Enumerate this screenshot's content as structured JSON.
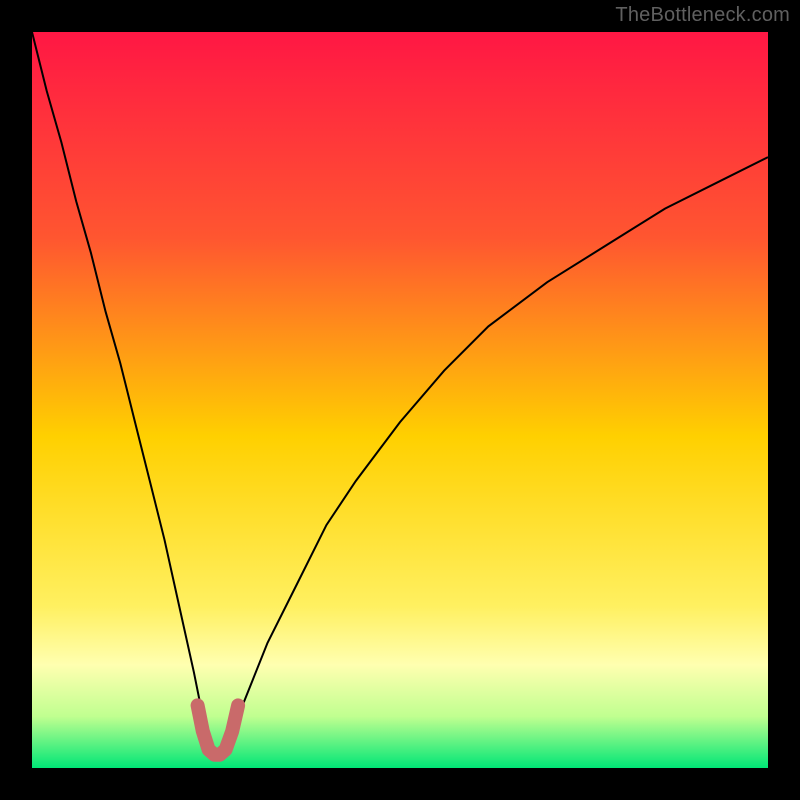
{
  "watermark": {
    "text": "TheBottleneck.com"
  },
  "chart_data": {
    "type": "line",
    "title": "",
    "xlabel": "",
    "ylabel": "",
    "xlim": [
      0,
      100
    ],
    "ylim": [
      0,
      100
    ],
    "gradient_stops": [
      {
        "offset": 0,
        "color": "#ff1744"
      },
      {
        "offset": 28,
        "color": "#ff5630"
      },
      {
        "offset": 55,
        "color": "#ffd000"
      },
      {
        "offset": 78,
        "color": "#fff060"
      },
      {
        "offset": 86,
        "color": "#ffffb0"
      },
      {
        "offset": 93,
        "color": "#c0ff90"
      },
      {
        "offset": 100,
        "color": "#00e676"
      }
    ],
    "series": [
      {
        "name": "bottleneck-curve",
        "stroke": "#000000",
        "stroke_width": 2,
        "x": [
          0,
          2,
          4,
          6,
          8,
          10,
          12,
          14,
          16,
          18,
          20,
          22,
          23,
          24,
          25,
          26,
          27,
          28,
          30,
          32,
          36,
          40,
          44,
          50,
          56,
          62,
          70,
          78,
          86,
          94,
          100
        ],
        "y": [
          100,
          92,
          85,
          77,
          70,
          62,
          55,
          47,
          39,
          31,
          22,
          13,
          8,
          4,
          2,
          2,
          4,
          7,
          12,
          17,
          25,
          33,
          39,
          47,
          54,
          60,
          66,
          71,
          76,
          80,
          83
        ]
      }
    ],
    "trough_marker": {
      "stroke": "#c96a6a",
      "stroke_width": 14,
      "x": [
        22.5,
        23.2,
        24.0,
        24.8,
        25.5,
        26.3,
        27.2,
        28.0
      ],
      "y": [
        8.5,
        5.0,
        2.5,
        1.8,
        1.8,
        2.5,
        5.0,
        8.5
      ]
    }
  }
}
